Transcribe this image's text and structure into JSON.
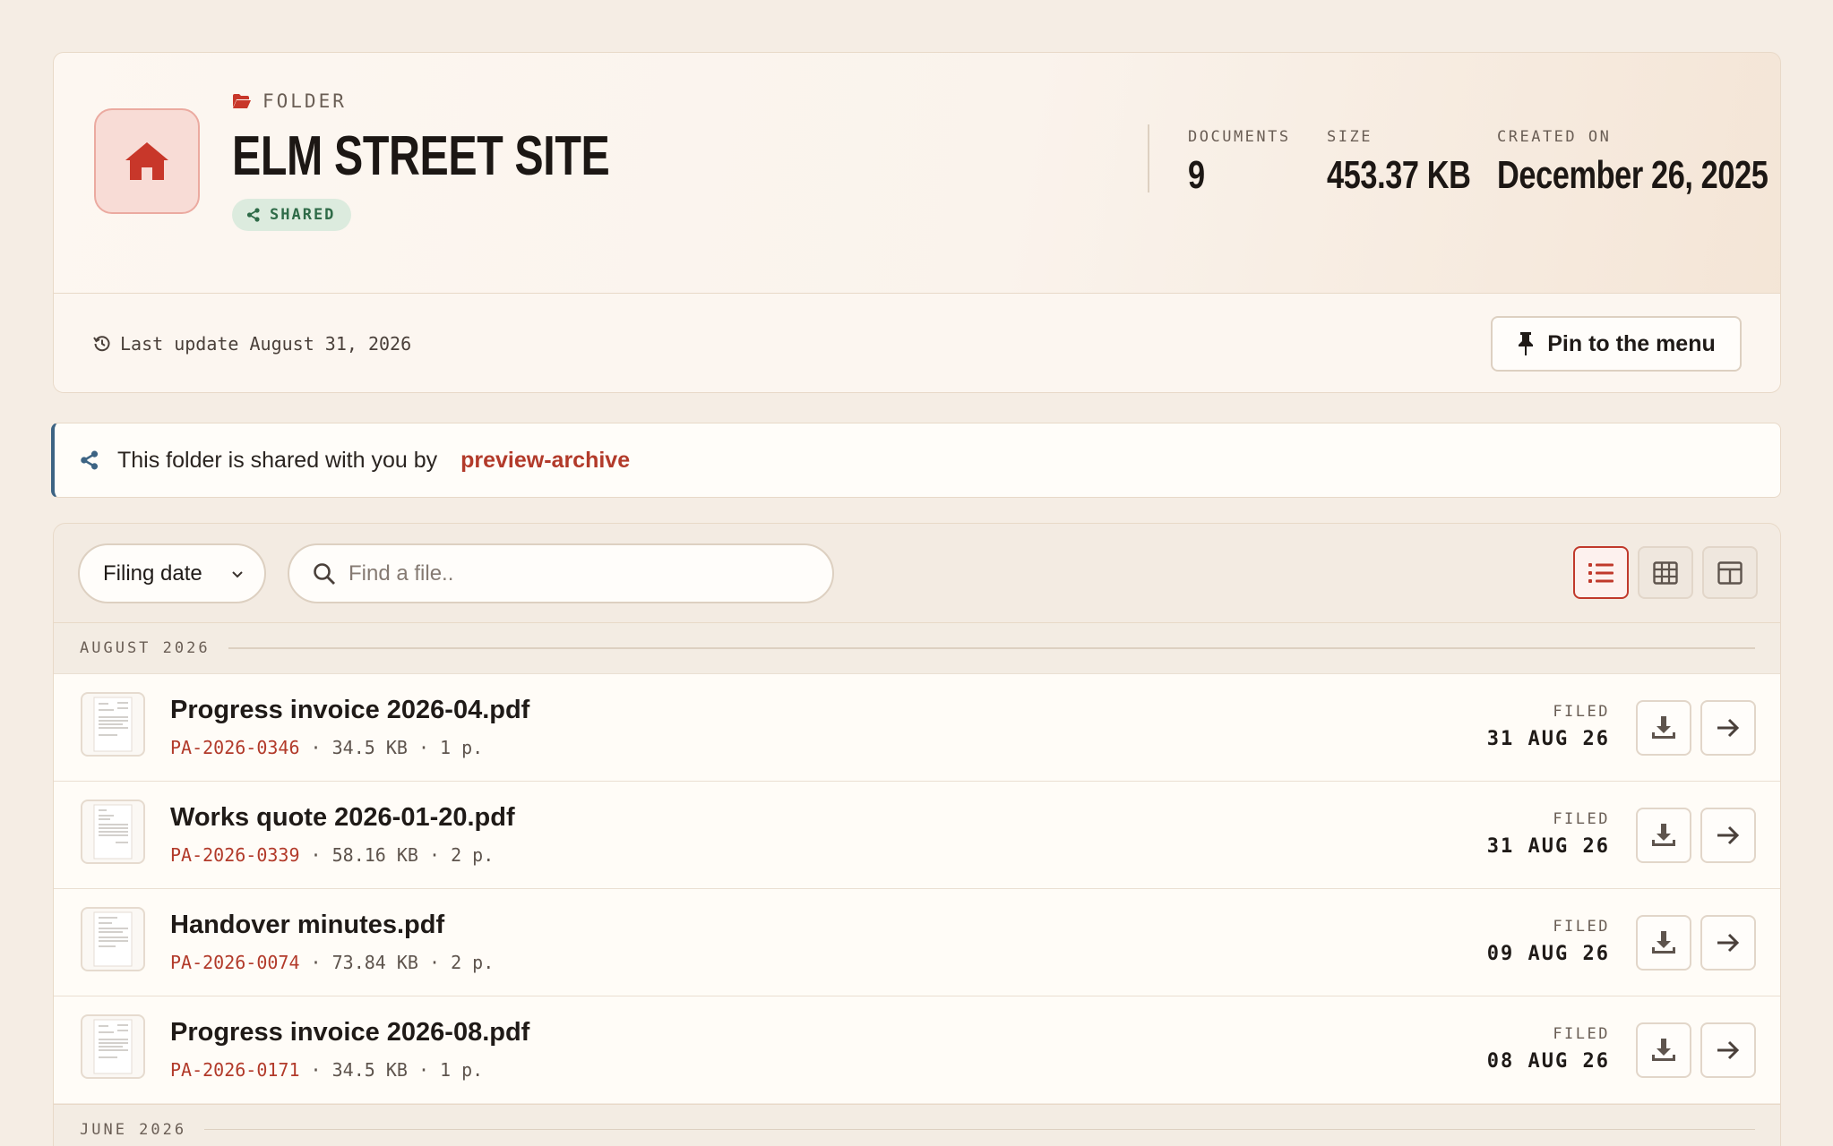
{
  "folder": {
    "kicker": "FOLDER",
    "title": "ELM STREET SITE",
    "badge": "SHARED",
    "icon": "house-icon",
    "stats": [
      {
        "label": "DOCUMENTS",
        "value": "9"
      },
      {
        "label": "SIZE",
        "value": "453.37 KB"
      },
      {
        "label": "CREATED ON",
        "value": "December 26, 2025"
      }
    ],
    "last_update": "Last update August 31, 2026",
    "pin_label": "Pin to the menu"
  },
  "share": {
    "text": "This folder is shared with you by",
    "owner": "preview-archive"
  },
  "toolbar": {
    "sort_value": "Filing date",
    "search_placeholder": "Find a file..",
    "views": [
      "list-view-icon",
      "grid-view-icon",
      "gallery-view-icon"
    ]
  },
  "groups": [
    {
      "label": "AUGUST 2026",
      "files": [
        {
          "name": "Progress invoice 2026-04.pdf",
          "ref": "PA-2026-0346",
          "size": "34.5 KB",
          "pages": "1 p.",
          "filed_label": "FILED",
          "filed_date": "31 AUG 26"
        },
        {
          "name": "Works quote 2026-01-20.pdf",
          "ref": "PA-2026-0339",
          "size": "58.16 KB",
          "pages": "2 p.",
          "filed_label": "FILED",
          "filed_date": "31 AUG 26"
        },
        {
          "name": "Handover minutes.pdf",
          "ref": "PA-2026-0074",
          "size": "73.84 KB",
          "pages": "2 p.",
          "filed_label": "FILED",
          "filed_date": "09 AUG 26"
        },
        {
          "name": "Progress invoice 2026-08.pdf",
          "ref": "PA-2026-0171",
          "size": "34.5 KB",
          "pages": "1 p.",
          "filed_label": "FILED",
          "filed_date": "08 AUG 26"
        }
      ]
    },
    {
      "label": "JUNE 2026",
      "files": []
    }
  ],
  "colors": {
    "accent": "#c0392b",
    "background": "#f5ede4",
    "shared_badge": "#2f6b48",
    "banner_border": "#3d6484"
  }
}
